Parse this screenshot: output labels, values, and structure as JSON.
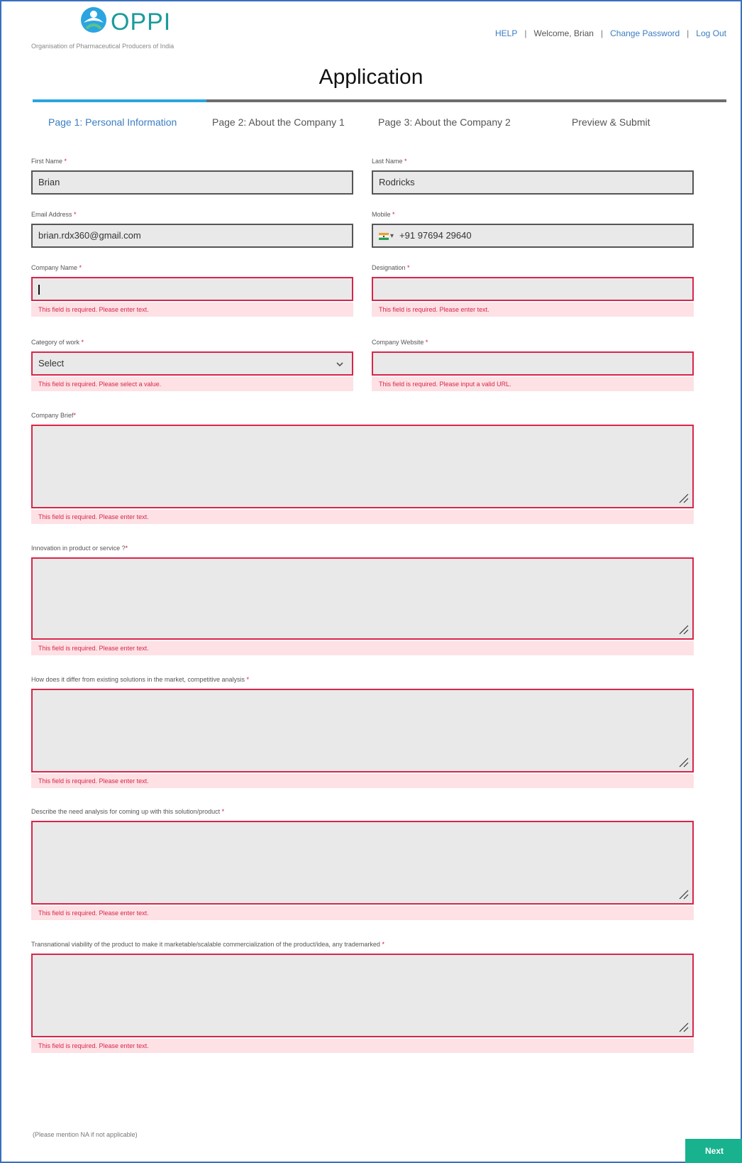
{
  "brand": {
    "logo_text": "OPPI",
    "tagline": "Organisation of Pharmaceutical Producers of India"
  },
  "topnav": {
    "help": "HELP",
    "welcome": "Welcome, Brian",
    "change_password": "Change Password",
    "logout": "Log Out"
  },
  "page_title": "Application",
  "progress": {
    "completed_fraction": 0.25
  },
  "tabs": [
    {
      "label": "Page 1: Personal Information",
      "active": true
    },
    {
      "label": "Page 2: About the Company 1",
      "active": false
    },
    {
      "label": "Page 3: About the Company 2",
      "active": false
    },
    {
      "label": "Preview & Submit",
      "active": false
    }
  ],
  "fields": {
    "first_name": {
      "label": "First Name",
      "value": "Brian"
    },
    "last_name": {
      "label": "Last Name",
      "value": "Rodricks"
    },
    "email": {
      "label": "Email Address",
      "value": "brian.rdx360@gmail.com"
    },
    "mobile": {
      "label": "Mobile",
      "value": "+91 97694 29640",
      "country": "India"
    },
    "company_name": {
      "label": "Company Name",
      "value": "",
      "error": "This field is required. Please enter text."
    },
    "designation": {
      "label": "Designation",
      "value": "",
      "error": "This field is required. Please enter text."
    },
    "category": {
      "label": "Category of work",
      "value": "Select",
      "error": "This field is required. Please select a value."
    },
    "website": {
      "label": "Company Website",
      "value": "",
      "error": "This field is required. Please input a valid URL."
    },
    "company_brief": {
      "label": "Company Brief",
      "error": "This field is required. Please enter text."
    },
    "innovation": {
      "label": "Innovation in product or service ?",
      "error": "This field is required. Please enter text."
    },
    "differ": {
      "label": "How does it differ from existing solutions in the market, competitive analysis",
      "error": "This field is required. Please enter text."
    },
    "need_analysis": {
      "label": "Describe the need analysis for coming up with this solution/product",
      "error": "This field is required. Please enter text."
    },
    "viability": {
      "label": "Transnational viability of the product to make it marketable/scalable commercialization of the product/idea, any trademarked",
      "error": "This field is required. Please enter text."
    }
  },
  "required_marker": "*",
  "note": "(Please mention NA if not applicable)",
  "next_button": "Next",
  "colors": {
    "accent_blue": "#2aa5e0",
    "link_blue": "#3a7dc2",
    "error_red": "#d8264a",
    "error_bg": "#fde1e5",
    "button_green": "#19b28e"
  }
}
